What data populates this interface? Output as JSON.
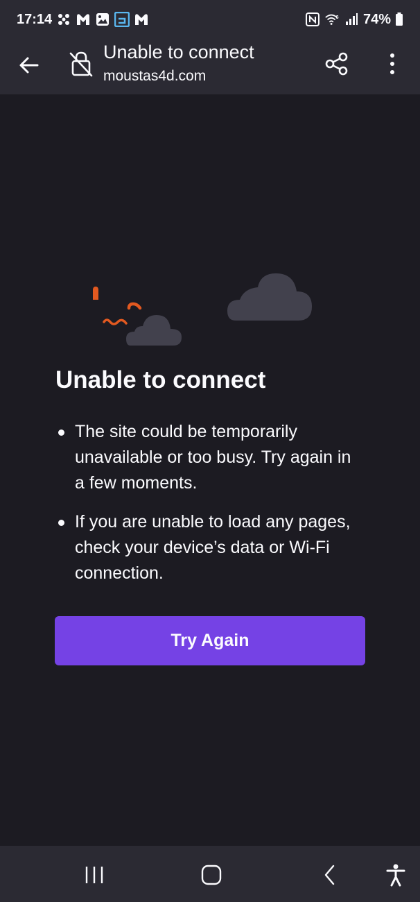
{
  "status_bar": {
    "time": "17:14",
    "battery": "74%",
    "left_icons": [
      "fan-icon",
      "malwarebytes-icon",
      "gallery-icon",
      "app-icon",
      "malwarebytes-icon"
    ],
    "right_icons": [
      "nfc-icon",
      "wifi-6-icon",
      "signal-icon",
      "battery-icon"
    ]
  },
  "toolbar": {
    "title": "Unable to connect",
    "url": "moustas4d.com",
    "back_icon": "arrow-left-icon",
    "security_icon": "broken-lock-icon",
    "share_icon": "share-icon",
    "menu_icon": "more-vertical-icon"
  },
  "error": {
    "title": "Unable to connect",
    "bullets": [
      "The site could be temporarily unavailable or too busy. Try again in a few moments.",
      "If you are unable to load any pages, check your device’s data or Wi-Fi connection."
    ],
    "button_label": "Try Again"
  },
  "nav_bar": {
    "items": [
      "recents-icon",
      "home-icon",
      "back-icon",
      "accessibility-icon"
    ]
  },
  "colors": {
    "background": "#1c1b22",
    "toolbar": "#2b2a33",
    "accent_button": "#7542e5",
    "text": "#fbfbfe",
    "illustration_orange": "#e25920",
    "illustration_cloud": "#42414d"
  }
}
